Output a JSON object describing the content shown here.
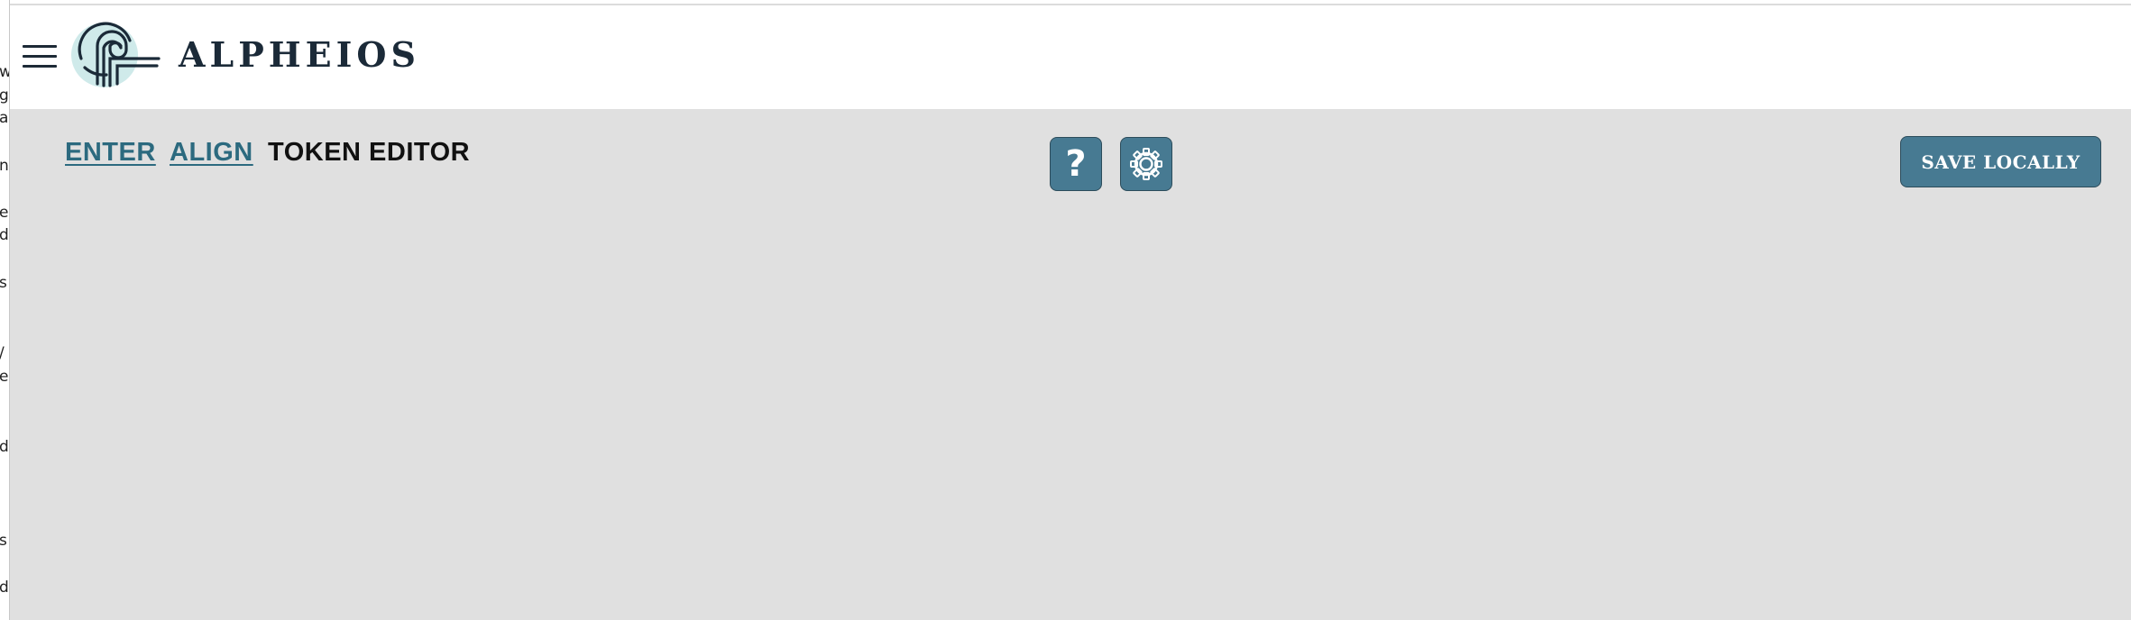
{
  "app": {
    "brand_name": "ALPHEIOS",
    "logo_icon": "alpheios-logo-icon"
  },
  "left_gutter": {
    "chars": [
      "w",
      "g",
      "a",
      "n",
      "e",
      "d",
      "s",
      "/",
      "e",
      "d",
      "s",
      "d"
    ]
  },
  "header": {
    "menu_icon": "hamburger-menu-icon"
  },
  "nav": {
    "enter_label": "ENTER",
    "align_label": "ALIGN",
    "token_editor_label": "TOKEN EDITOR"
  },
  "toolbar": {
    "help_label": "?",
    "help_icon": "question-mark-icon",
    "settings_icon": "gear-icon",
    "save_label": "SAVE LOCALLY"
  },
  "colors": {
    "accent": "#477a92",
    "link": "#2c6a7f",
    "toolbar_bg": "#e0e0e0",
    "brand_text": "#1b2a38",
    "logo_bg": "#cfeaea"
  }
}
